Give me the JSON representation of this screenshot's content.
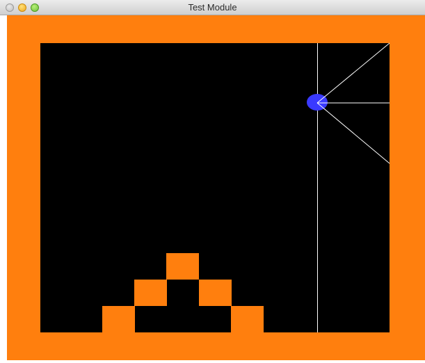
{
  "window": {
    "title": "Test Module"
  },
  "colors": {
    "frame": "#ff7f0e",
    "arena": "#000000",
    "agent": "#3a3aff",
    "sensor_ray": "#ffffff",
    "wall_block": "#ff7f0e"
  },
  "icons": {
    "close": "close-icon",
    "minimize": "minimize-icon",
    "zoom": "zoom-icon"
  }
}
